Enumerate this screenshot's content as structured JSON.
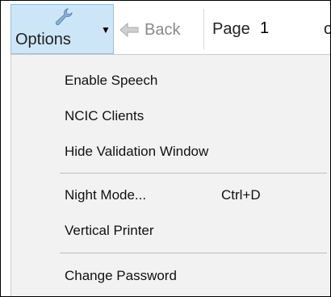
{
  "toolbar": {
    "options_label": "Options",
    "back_label": "Back",
    "page_label": "Page",
    "page_value": "1",
    "page_trailing": "o"
  },
  "menu": {
    "items": [
      {
        "label": "Enable Speech",
        "shortcut": ""
      },
      {
        "label": "NCIC Clients",
        "shortcut": ""
      },
      {
        "label": "Hide Validation Window",
        "shortcut": ""
      },
      {
        "label": "Night Mode...",
        "shortcut": "Ctrl+D"
      },
      {
        "label": "Vertical Printer",
        "shortcut": ""
      },
      {
        "label": "Change Password",
        "shortcut": ""
      }
    ]
  },
  "icons": {
    "options": "wrench-icon",
    "dropdown": "caret-down-icon",
    "back": "arrow-left-icon"
  },
  "colors": {
    "options_button_bg": "#cde6f7",
    "options_button_border": "#8fc1e8",
    "menu_bg": "#f2f2f2",
    "disabled_text": "#8a8a8a"
  }
}
